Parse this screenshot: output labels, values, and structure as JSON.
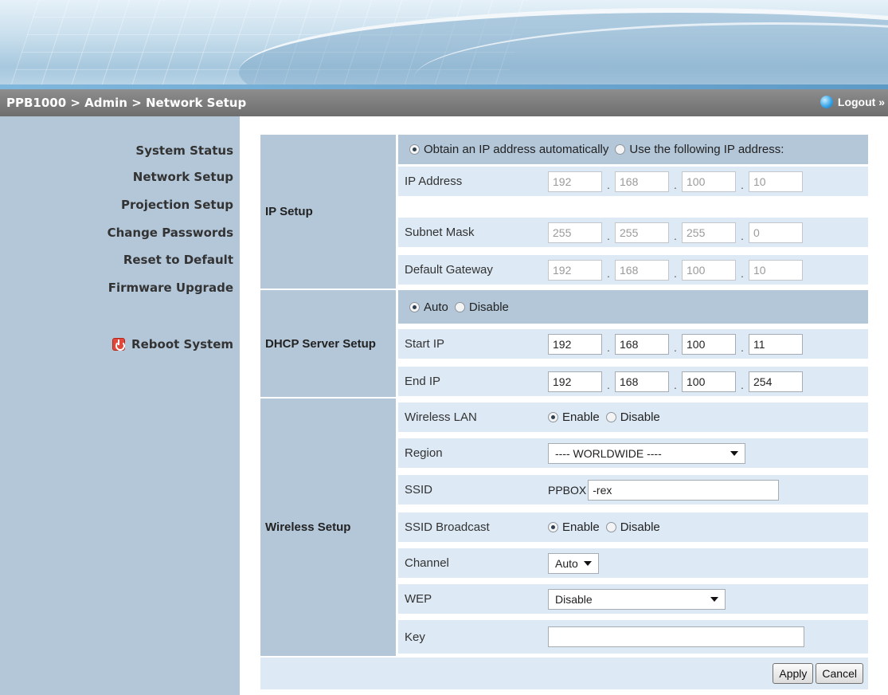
{
  "titlebar": {
    "breadcrumb": "PPB1000 > Admin > Network Setup",
    "logout": "Logout »"
  },
  "sidebar": {
    "items": [
      "System Status",
      "Network Setup",
      "Projection Setup",
      "Change Passwords",
      "Reset to Default",
      "Firmware Upgrade"
    ],
    "reboot": "Reboot System"
  },
  "ip_setup": {
    "label": "IP Setup",
    "mode_auto": "Obtain an IP address automatically",
    "mode_manual": "Use the following IP address:",
    "selected_mode": "auto",
    "ip_label": "IP Address",
    "ip": [
      "192",
      "168",
      "100",
      "10"
    ],
    "mask_label": "Subnet Mask",
    "mask": [
      "255",
      "255",
      "255",
      "0"
    ],
    "gateway_label": "Default Gateway",
    "gateway": [
      "192",
      "168",
      "100",
      "10"
    ]
  },
  "dhcp": {
    "label": "DHCP Server Setup",
    "opt_auto": "Auto",
    "opt_disable": "Disable",
    "selected": "auto",
    "start_label": "Start IP",
    "start": [
      "192",
      "168",
      "100",
      "11"
    ],
    "end_label": "End IP",
    "end": [
      "192",
      "168",
      "100",
      "254"
    ]
  },
  "wireless": {
    "label": "Wireless Setup",
    "wlan_label": "Wireless LAN",
    "enable": "Enable",
    "disable": "Disable",
    "wlan_selected": "enable",
    "region_label": "Region",
    "region_value": "---- WORLDWIDE ----",
    "ssid_label": "SSID",
    "ssid_prefix": "PPBOX",
    "ssid_value": "-rex",
    "broadcast_label": "SSID Broadcast",
    "broadcast_selected": "enable",
    "channel_label": "Channel",
    "channel_value": "Auto",
    "wep_label": "WEP",
    "wep_value": "Disable",
    "key_label": "Key",
    "key_value": ""
  },
  "buttons": {
    "apply": "Apply",
    "cancel": "Cancel"
  },
  "colors": {
    "sidebar": "#b3c7d9",
    "row": "#dde9f4",
    "titlebar": "#7a7a7a"
  }
}
